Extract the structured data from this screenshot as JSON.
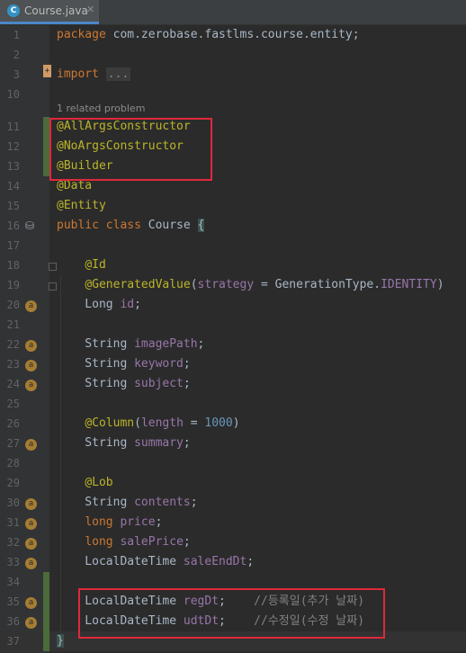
{
  "tab": {
    "label": "Course.java",
    "icon": "java-class-icon",
    "icon_glyph": "C",
    "close_glyph": "✕"
  },
  "hint": "1 related problem",
  "lines": [
    {
      "num": "1",
      "parts": [
        [
          "kw",
          "package "
        ],
        [
          "txt",
          "com.zerobase.fastlms.course.entity;"
        ]
      ]
    },
    {
      "num": "2",
      "parts": []
    },
    {
      "num": "3",
      "parts": [
        [
          "kw",
          "import "
        ],
        [
          "fold",
          "..."
        ]
      ]
    },
    {
      "num": "10",
      "parts": []
    },
    {
      "num": "11",
      "parts": [
        [
          "ann",
          "@AllArgsConstructor"
        ]
      ]
    },
    {
      "num": "12",
      "parts": [
        [
          "ann",
          "@NoArgsConstructor"
        ]
      ]
    },
    {
      "num": "13",
      "parts": [
        [
          "ann",
          "@Builder"
        ]
      ]
    },
    {
      "num": "14",
      "parts": [
        [
          "ann",
          "@Data"
        ]
      ]
    },
    {
      "num": "15",
      "parts": [
        [
          "ann",
          "@Entity"
        ]
      ]
    },
    {
      "num": "16",
      "parts": [
        [
          "kw",
          "public class "
        ],
        [
          "txt",
          "Course "
        ],
        [
          "brace",
          "{"
        ]
      ]
    },
    {
      "num": "17",
      "parts": []
    },
    {
      "num": "18",
      "parts": [
        [
          "txt",
          "    "
        ],
        [
          "ann",
          "@Id"
        ]
      ]
    },
    {
      "num": "19",
      "parts": [
        [
          "txt",
          "    "
        ],
        [
          "ann",
          "@GeneratedValue"
        ],
        [
          "txt",
          "("
        ],
        [
          "kw2",
          "strategy"
        ],
        [
          "txt",
          " = GenerationType."
        ],
        [
          "fld",
          "IDENTITY"
        ],
        [
          "txt",
          ")"
        ]
      ]
    },
    {
      "num": "20",
      "parts": [
        [
          "txt",
          "    Long "
        ],
        [
          "fld",
          "id"
        ],
        [
          "txt",
          ";"
        ]
      ]
    },
    {
      "num": "21",
      "parts": []
    },
    {
      "num": "22",
      "parts": [
        [
          "txt",
          "    String "
        ],
        [
          "fld",
          "imagePath"
        ],
        [
          "txt",
          ";"
        ]
      ]
    },
    {
      "num": "23",
      "parts": [
        [
          "txt",
          "    String "
        ],
        [
          "fld",
          "keyword"
        ],
        [
          "txt",
          ";"
        ]
      ]
    },
    {
      "num": "24",
      "parts": [
        [
          "txt",
          "    String "
        ],
        [
          "fld",
          "subject"
        ],
        [
          "txt",
          ";"
        ]
      ]
    },
    {
      "num": "25",
      "parts": []
    },
    {
      "num": "26",
      "parts": [
        [
          "txt",
          "    "
        ],
        [
          "ann",
          "@Column"
        ],
        [
          "txt",
          "("
        ],
        [
          "kw2",
          "length"
        ],
        [
          "txt",
          " = "
        ],
        [
          "num",
          "1000"
        ],
        [
          "txt",
          ")"
        ]
      ]
    },
    {
      "num": "27",
      "parts": [
        [
          "txt",
          "    String "
        ],
        [
          "fld",
          "summary"
        ],
        [
          "txt",
          ";"
        ]
      ]
    },
    {
      "num": "28",
      "parts": []
    },
    {
      "num": "29",
      "parts": [
        [
          "txt",
          "    "
        ],
        [
          "ann",
          "@Lob"
        ]
      ]
    },
    {
      "num": "30",
      "parts": [
        [
          "txt",
          "    String "
        ],
        [
          "fld",
          "contents"
        ],
        [
          "txt",
          ";"
        ]
      ]
    },
    {
      "num": "31",
      "parts": [
        [
          "txt",
          "    "
        ],
        [
          "kw",
          "long "
        ],
        [
          "fld",
          "price"
        ],
        [
          "txt",
          ";"
        ]
      ]
    },
    {
      "num": "32",
      "parts": [
        [
          "txt",
          "    "
        ],
        [
          "kw",
          "long "
        ],
        [
          "fld",
          "salePrice"
        ],
        [
          "txt",
          ";"
        ]
      ]
    },
    {
      "num": "33",
      "parts": [
        [
          "txt",
          "    LocalDateTime "
        ],
        [
          "fld",
          "saleEndDt"
        ],
        [
          "txt",
          ";"
        ]
      ]
    },
    {
      "num": "34",
      "parts": []
    },
    {
      "num": "35",
      "parts": [
        [
          "txt",
          "    LocalDateTime "
        ],
        [
          "fld",
          "regDt"
        ],
        [
          "txt",
          ";    "
        ],
        [
          "cmt",
          "//등록일(추가 날짜)"
        ]
      ]
    },
    {
      "num": "36",
      "parts": [
        [
          "txt",
          "    LocalDateTime "
        ],
        [
          "fld",
          "udtDt"
        ],
        [
          "txt",
          ";    "
        ],
        [
          "cmt",
          "//수정일(수정 날짜)"
        ]
      ]
    },
    {
      "num": "37",
      "parts": [
        [
          "brace",
          "}"
        ]
      ]
    }
  ],
  "gutter_icons": {
    "db_glyph": "⛁",
    "field_glyph": "a",
    "fold_marker_glyph": "+"
  },
  "colors": {
    "background": "#2b2b2b",
    "gutter": "#313335",
    "highlight_box": "#e0283b"
  }
}
